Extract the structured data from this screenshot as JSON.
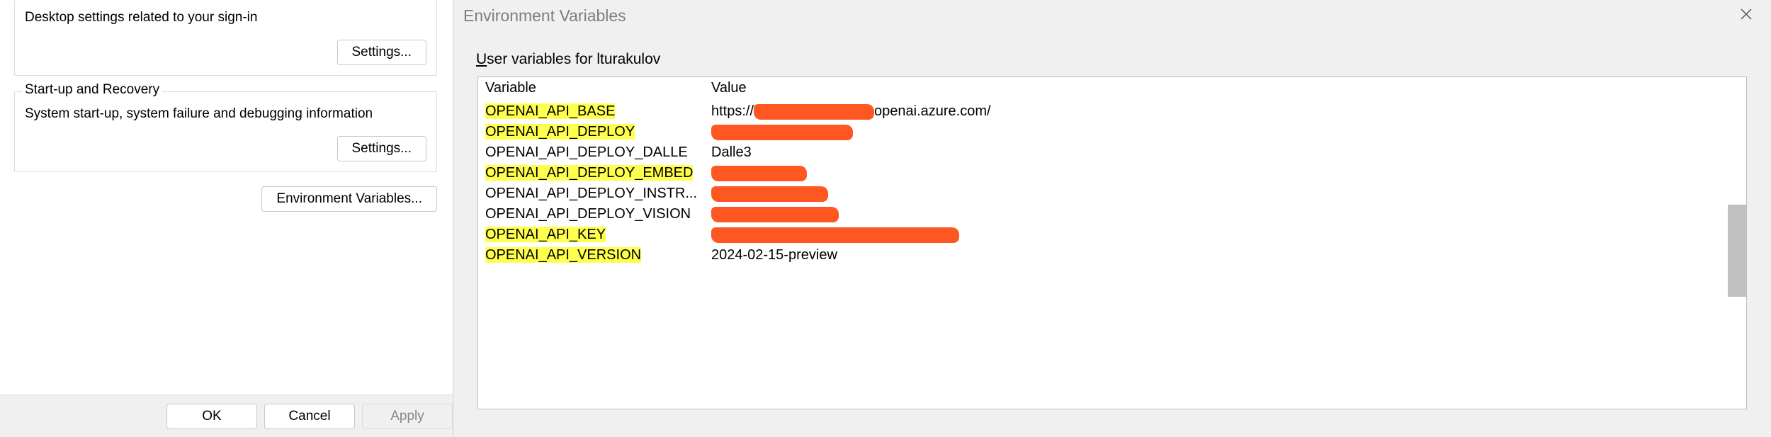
{
  "left": {
    "user_profiles_desc": "Desktop settings related to your sign-in",
    "settings_btn": "Settings...",
    "startup_title": "Start-up and Recovery",
    "startup_desc": "System start-up, system failure and debugging information",
    "env_btn": "Environment Variables...",
    "ok": "OK",
    "cancel": "Cancel",
    "apply": "Apply"
  },
  "right": {
    "title": "Environment Variables",
    "section_label_prefix": "U",
    "section_label_rest": "ser variables for lturakulov",
    "col_variable": "Variable",
    "col_value": "Value",
    "rows": [
      {
        "var": "OPENAI_API_BASE",
        "hl": true,
        "value_prefix": "https://",
        "value_redact_w": 170,
        "value_suffix": "openai.azure.com/"
      },
      {
        "var": "OPENAI_API_DEPLOY",
        "hl": true,
        "value_prefix": "",
        "value_redact_w": 200,
        "value_suffix": ""
      },
      {
        "var": "OPENAI_API_DEPLOY_DALLE",
        "hl": false,
        "value_prefix": "Dalle3",
        "value_redact_w": 0,
        "value_suffix": ""
      },
      {
        "var": "OPENAI_API_DEPLOY_EMBED",
        "hl": true,
        "value_prefix": "",
        "value_redact_w": 135,
        "value_suffix": ""
      },
      {
        "var": "OPENAI_API_DEPLOY_INSTR...",
        "hl": false,
        "value_prefix": "",
        "value_redact_w": 165,
        "value_suffix": ""
      },
      {
        "var": "OPENAI_API_DEPLOY_VISION",
        "hl": false,
        "value_prefix": "",
        "value_redact_w": 180,
        "value_suffix": ""
      },
      {
        "var": "OPENAI_API_KEY",
        "hl": true,
        "value_prefix": "",
        "value_redact_w": 350,
        "value_suffix": ""
      },
      {
        "var": "OPENAI_API_VERSION",
        "hl": true,
        "value_prefix": "2024-02-15-preview",
        "value_redact_w": 0,
        "value_suffix": ""
      }
    ]
  }
}
